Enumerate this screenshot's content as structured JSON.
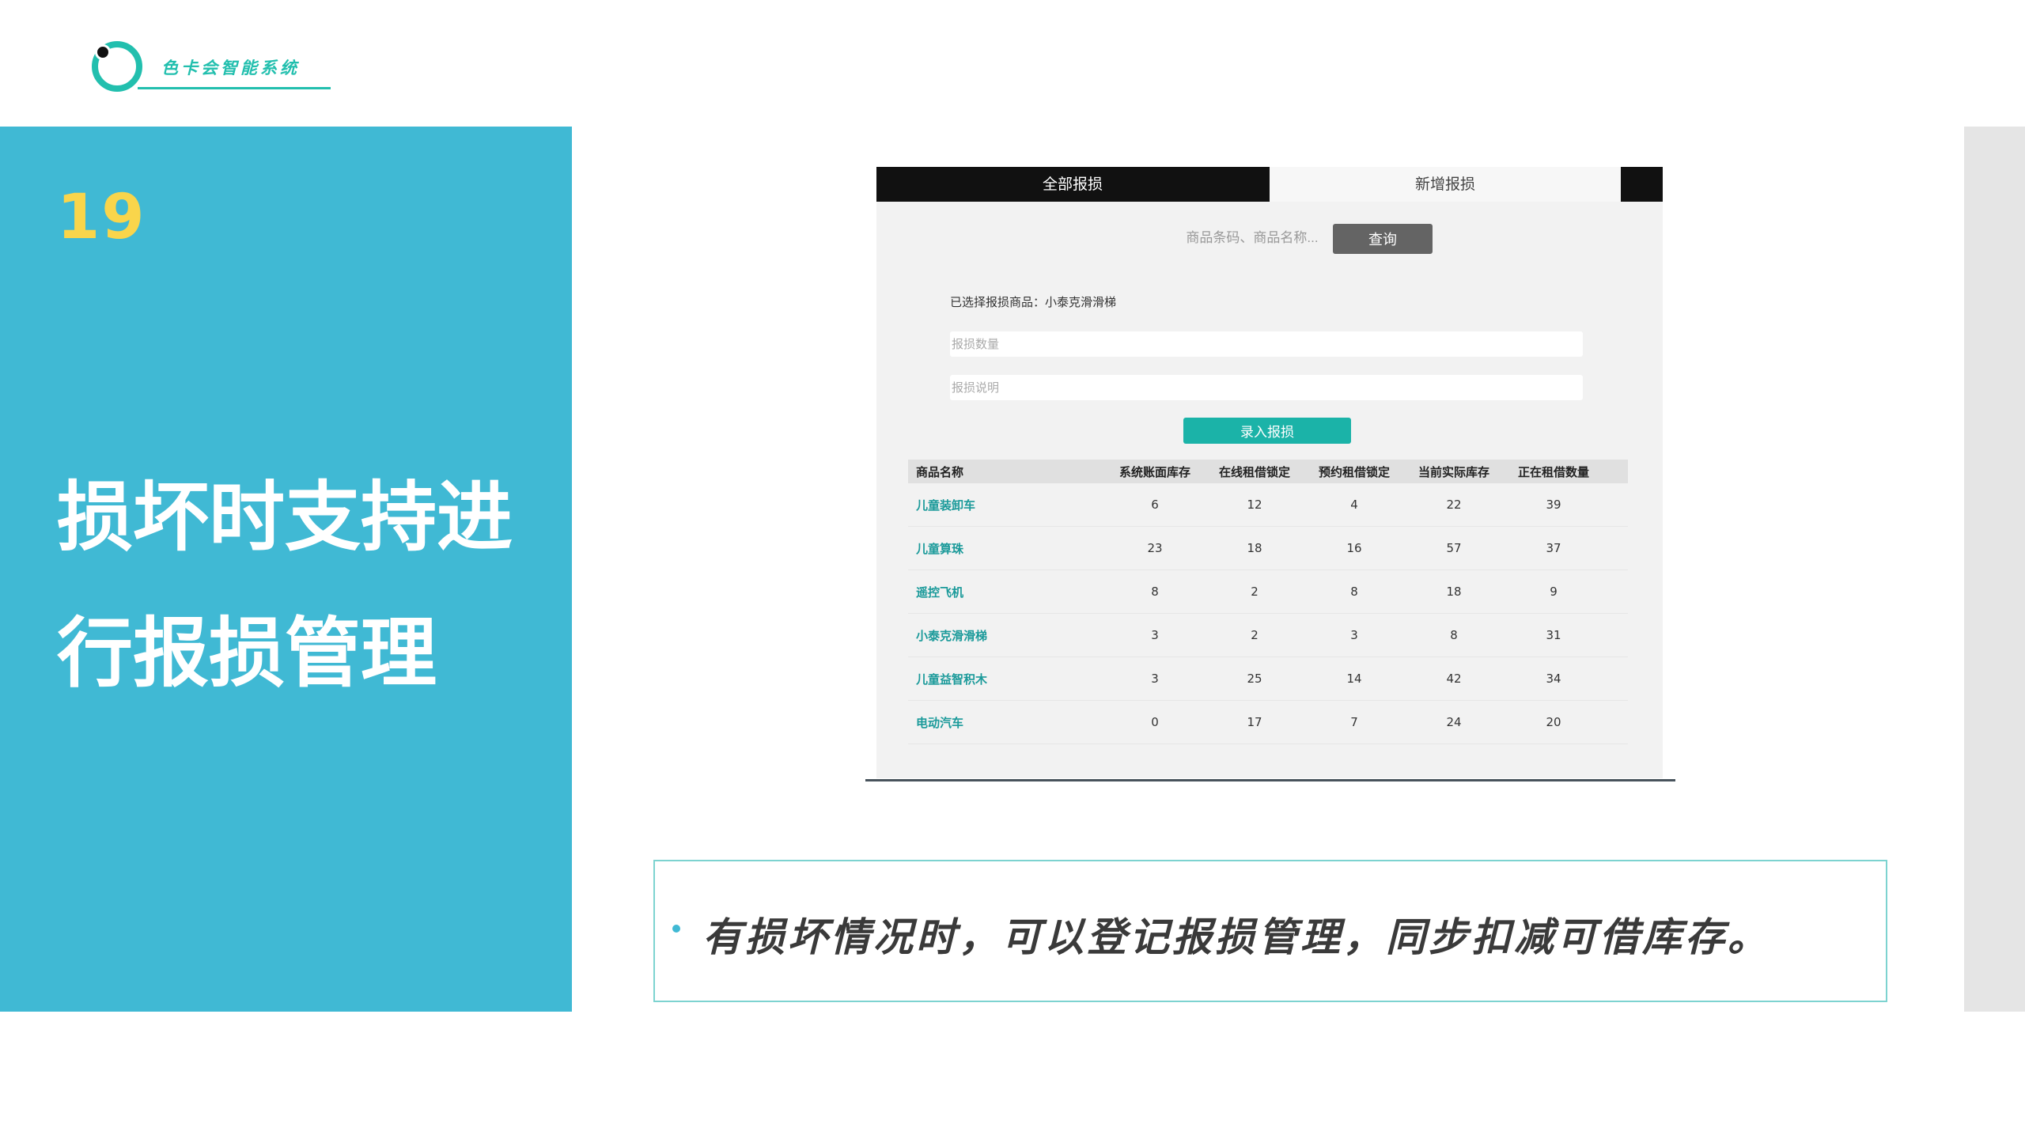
{
  "logo": {
    "text": "色卡会智能系统"
  },
  "slide": {
    "number": "19",
    "title": "损坏时支持进行报损管理"
  },
  "app": {
    "tabs": {
      "all": "全部报损",
      "new": "新增报损"
    },
    "search": {
      "placeholder": "商品条码、商品名称...",
      "button": "查询"
    },
    "selected_info": "已选择报损商品：小泰克滑滑梯",
    "fields": {
      "quantity_placeholder": "报损数量",
      "description_placeholder": "报损说明"
    },
    "submit": "录入报损",
    "table": {
      "headers": [
        "商品名称",
        "系统账面库存",
        "在线租借锁定",
        "预约租借锁定",
        "当前实际库存",
        "正在租借数量"
      ],
      "rows": [
        [
          "儿童装卸车",
          "6",
          "12",
          "4",
          "22",
          "39"
        ],
        [
          "儿童算珠",
          "23",
          "18",
          "16",
          "57",
          "37"
        ],
        [
          "遥控飞机",
          "8",
          "2",
          "8",
          "18",
          "9"
        ],
        [
          "小泰克滑滑梯",
          "3",
          "2",
          "3",
          "8",
          "31"
        ],
        [
          "儿童益智积木",
          "3",
          "25",
          "14",
          "42",
          "34"
        ],
        [
          "电动汽车",
          "0",
          "17",
          "7",
          "24",
          "20"
        ]
      ]
    }
  },
  "description": "有损坏情况时，可以登记报损管理，同步扣减可借库存。",
  "colors": {
    "panel": "#40b9d4",
    "accent": "#22bfae",
    "number": "#f9d54b"
  }
}
